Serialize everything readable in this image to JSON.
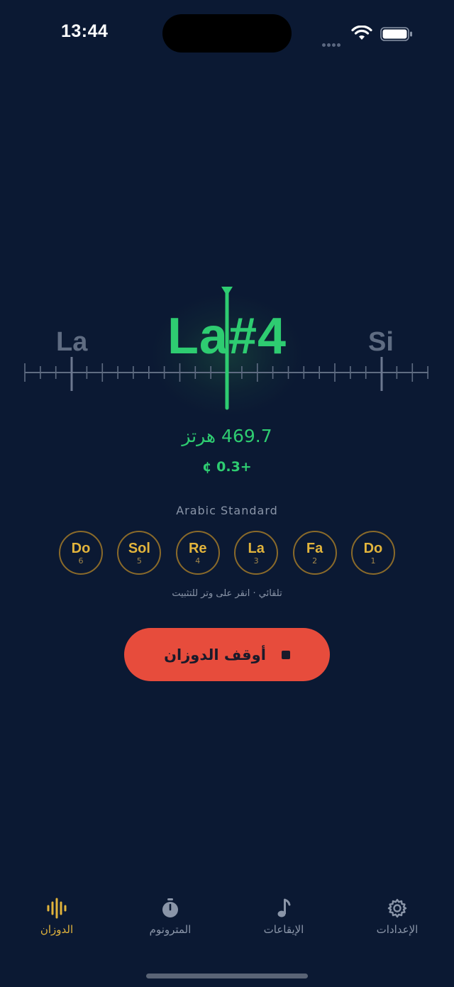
{
  "status": {
    "time": "13:44"
  },
  "tuner": {
    "current_note": "La#4",
    "prev_note": "La",
    "next_note": "Si",
    "frequency": "469.7 هرتز",
    "cents": "+0.3 ¢",
    "accent_color": "#2ecc71"
  },
  "tuning": {
    "name": "Arabic Standard",
    "strings": [
      {
        "note": "Do",
        "number": "6"
      },
      {
        "note": "Sol",
        "number": "5"
      },
      {
        "note": "Re",
        "number": "4"
      },
      {
        "note": "La",
        "number": "3"
      },
      {
        "note": "Fa",
        "number": "2"
      },
      {
        "note": "Do",
        "number": "1"
      }
    ],
    "hint": "تلقائي · انقر على وتر للتثبيت"
  },
  "actions": {
    "stop_label": "أوقف الدوزان",
    "stop_color": "#e74c3c"
  },
  "tabs": [
    {
      "label": "الدوزان",
      "icon": "waveform-icon",
      "active": true
    },
    {
      "label": "المترونوم",
      "icon": "stopwatch-icon",
      "active": false
    },
    {
      "label": "الإيقاعات",
      "icon": "music-note-icon",
      "active": false
    },
    {
      "label": "الإعدادات",
      "icon": "gear-icon",
      "active": false
    }
  ],
  "colors": {
    "background": "#0b1933",
    "active_tab": "#e2b43c"
  }
}
